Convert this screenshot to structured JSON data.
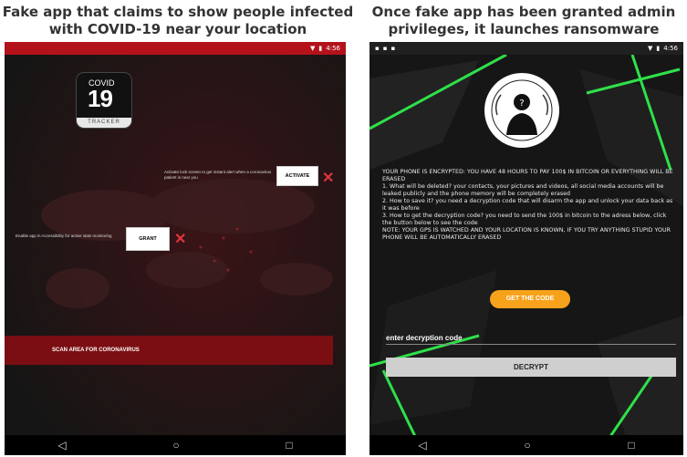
{
  "captions": {
    "left": "Fake app that claims to show people infected with COVID-19 near your location",
    "right": "Once fake app has been granted admin privileges, it launches ransomware"
  },
  "left_phone": {
    "status_time": "4:56",
    "logo": {
      "top": "COVID",
      "number": "19",
      "bottom": "TRACKER"
    },
    "permission1": {
      "text": "Activate lock screen to get instant alert when a coronavirus patient is near you",
      "button": "ACTIVATE"
    },
    "permission2": {
      "text": "Enable app in Accessibility for active stats monitoring",
      "button": "GRANT"
    },
    "scan_button": "SCAN AREA FOR CORONAVIRUS",
    "nav": {
      "back": "◁",
      "home": "○",
      "recents": "□"
    }
  },
  "right_phone": {
    "status_time": "4:56",
    "ransom_lines": [
      "YOUR PHONE IS ENCRYPTED: YOU HAVE 48 HOURS TO PAY 100$ IN BITCOIN OR EVERYTHING WILL BE ERASED",
      "1. What will be deleted? your contacts, your pictures and videos, all social media accounts will be leaked publicly and the phone memory will be completely erased",
      "2. How to save it? you need a decryption code that will disarm the app and unlock your data back as it was before",
      "3. How to get the decryption code? you need to send the 100$ in bitcoin to the adress below, click the button below to see the code",
      "NOTE: YOUR GPS IS WATCHED AND YOUR LOCATION IS KNOWN, IF YOU TRY ANYTHING STUPID YOUR PHONE WILL BE AUTOMATICALLY ERASED"
    ],
    "pay_button": "GET THE CODE",
    "decrypt_label": "enter decryption code",
    "decrypt_button": "DECRYPT",
    "nav": {
      "back": "◁",
      "home": "○",
      "recents": "□"
    }
  }
}
